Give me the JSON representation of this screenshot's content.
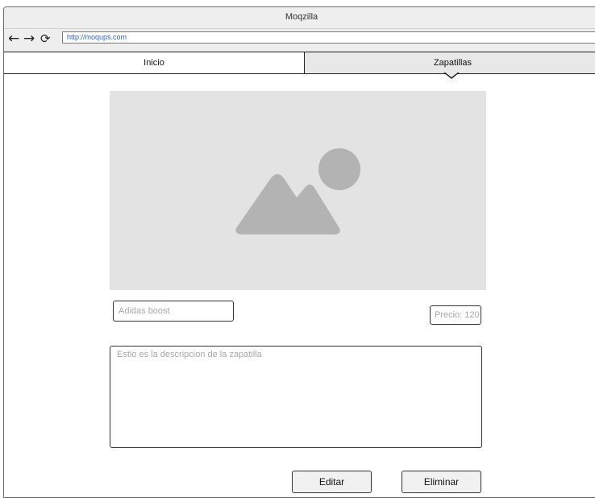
{
  "window": {
    "title": "Moqzilla",
    "address": "http://moqups.com"
  },
  "toolbar": {
    "back_icon": "back-arrow-icon",
    "forward_icon": "forward-arrow-icon",
    "reload_icon": "reload-icon"
  },
  "tabs": [
    {
      "label": "Inicio",
      "active": false
    },
    {
      "label": "Zapatillas",
      "active": true
    }
  ],
  "product": {
    "image_icon": "image-placeholder-icon",
    "name_placeholder": "Adidas boost",
    "price_placeholder": "Precio: 120",
    "description_placeholder": "Estio es la descripcion de la zapatilla"
  },
  "actions": {
    "edit_label": "Editar",
    "delete_label": "Eliminar"
  },
  "colors": {
    "chrome": "#eeeeee",
    "active_tab": "#e8e8e8",
    "placeholder_bg": "#e3e3e3",
    "placeholder_shape": "#b3b3b3",
    "link": "#3564b7"
  }
}
